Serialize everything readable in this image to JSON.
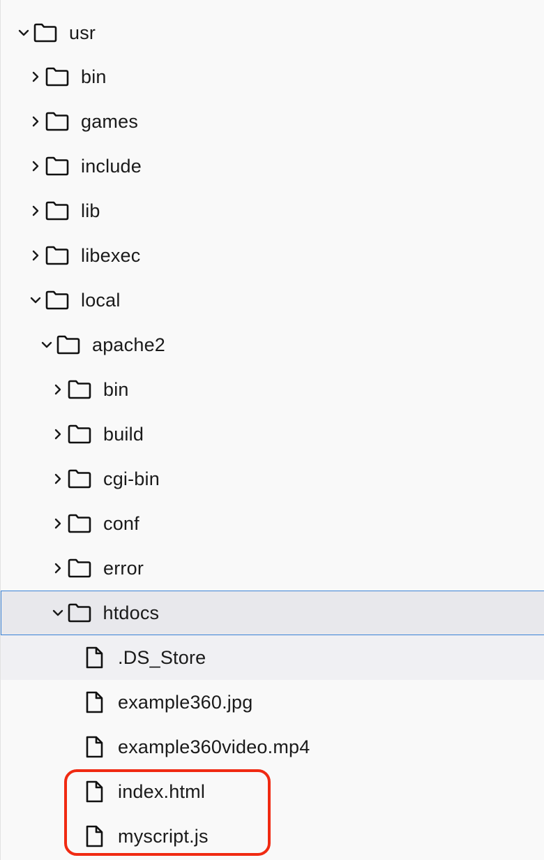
{
  "tree": {
    "items": [
      {
        "label": "usr",
        "type": "folder",
        "expanded": true
      },
      {
        "label": "bin",
        "type": "folder",
        "expanded": false
      },
      {
        "label": "games",
        "type": "folder",
        "expanded": false
      },
      {
        "label": "include",
        "type": "folder",
        "expanded": false
      },
      {
        "label": "lib",
        "type": "folder",
        "expanded": false
      },
      {
        "label": "libexec",
        "type": "folder",
        "expanded": false
      },
      {
        "label": "local",
        "type": "folder",
        "expanded": true
      },
      {
        "label": "apache2",
        "type": "folder",
        "expanded": true
      },
      {
        "label": "bin",
        "type": "folder",
        "expanded": false
      },
      {
        "label": "build",
        "type": "folder",
        "expanded": false
      },
      {
        "label": "cgi-bin",
        "type": "folder",
        "expanded": false
      },
      {
        "label": "conf",
        "type": "folder",
        "expanded": false
      },
      {
        "label": "error",
        "type": "folder",
        "expanded": false
      },
      {
        "label": "htdocs",
        "type": "folder",
        "expanded": true,
        "selected": true
      },
      {
        "label": ".DS_Store",
        "type": "file"
      },
      {
        "label": "example360.jpg",
        "type": "file"
      },
      {
        "label": "example360video.mp4",
        "type": "file"
      },
      {
        "label": "index.html",
        "type": "file"
      },
      {
        "label": "myscript.js",
        "type": "file"
      }
    ]
  },
  "colors": {
    "selection_border": "#3a82d6",
    "selection_bg": "#e8e8ec",
    "annotation_box": "#f02a12"
  }
}
